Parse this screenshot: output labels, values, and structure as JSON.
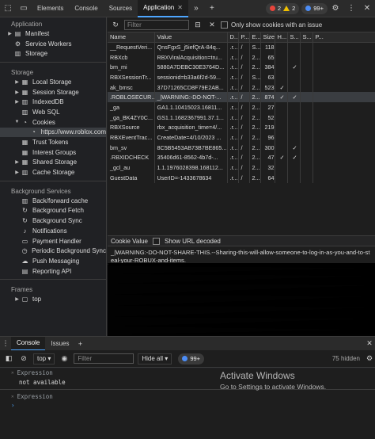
{
  "toolbar": {
    "tabs": [
      "Elements",
      "Console",
      "Sources",
      "Application"
    ],
    "active_tab": "Application",
    "errors": "2",
    "warnings": "2",
    "issues": "99+"
  },
  "sidebar": {
    "application_title": "Application",
    "application_items": [
      "Manifest",
      "Service Workers",
      "Storage"
    ],
    "storage_title": "Storage",
    "storage_items": [
      "Local Storage",
      "Session Storage",
      "IndexedDB",
      "Web SQL",
      "Cookies",
      "https://www.roblox.com",
      "Trust Tokens",
      "Interest Groups",
      "Shared Storage",
      "Cache Storage"
    ],
    "background_title": "Background Services",
    "background_items": [
      "Back/forward cache",
      "Background Fetch",
      "Background Sync",
      "Notifications",
      "Payment Handler",
      "Periodic Background Sync",
      "Push Messaging",
      "Reporting API"
    ],
    "frames_title": "Frames",
    "frames_items": [
      "top"
    ]
  },
  "filter": {
    "placeholder": "Filter",
    "only_issue_label": "Only show cookies with an issue"
  },
  "table": {
    "headers": [
      "Name",
      "Value",
      "D...",
      "P...",
      "E...",
      "Size",
      "H...",
      "S...",
      "S...",
      "P..."
    ],
    "rows": [
      [
        "__RequestVeri...",
        "QnsFgxS_j5iefQrA-84q...",
        ".r...",
        "/",
        "S...",
        "118",
        "",
        "",
        "",
        ""
      ],
      [
        "RBXcb",
        "RBXViralAcquisition=tru...",
        ".r...",
        "/",
        "2...",
        "65",
        "",
        "",
        "",
        ""
      ],
      [
        "bm_mi",
        "5880A7DEBC30E3764D...",
        ".r...",
        "/",
        "2...",
        "384",
        "",
        "✓",
        "",
        ""
      ],
      [
        "RBXSessionTr...",
        "sessionid=b33a6f2d-59...",
        ".r...",
        "/",
        "S...",
        "63",
        "",
        "",
        "",
        ""
      ],
      [
        "ak_bmsc",
        "37D71265CD8F79E2AB...",
        ".r...",
        "/",
        "2...",
        "523",
        "✓",
        "",
        "",
        ""
      ],
      [
        ".ROBLOSECUR...",
        "_|WARNING:-DO-NOT-...",
        ".r...",
        "/",
        "2...",
        "874",
        "✓",
        "✓",
        "",
        ""
      ],
      [
        "_ga",
        "GA1.1.10415023.16811...",
        ".r...",
        "/",
        "2...",
        "27",
        "",
        "",
        "",
        ""
      ],
      [
        "_ga_BK4ZY0C...",
        "GS1.1.1682367991.37.1...",
        ".r...",
        "/",
        "2...",
        "52",
        "",
        "",
        "",
        ""
      ],
      [
        "RBXSource",
        "rbx_acquisition_time=4/...",
        ".r...",
        "/",
        "2...",
        "219",
        "",
        "",
        "",
        ""
      ],
      [
        "RBXEventTrac...",
        "CreateDate=4/10/2023 ...",
        ".r...",
        "/",
        "2...",
        "96",
        "",
        "",
        "",
        ""
      ],
      [
        "bm_sv",
        "8C5B5453AB73B7BE865...",
        ".r...",
        "/",
        "2...",
        "300",
        "",
        "✓",
        "",
        ""
      ],
      [
        ".RBXIDCHECK",
        "35406d61-8562-4b7d-...",
        ".r...",
        "/",
        "2...",
        "47",
        "✓",
        "✓",
        "",
        ""
      ],
      [
        "_gcl_au",
        "1.1.1976028398.168112...",
        ".r...",
        "/",
        "2...",
        "32",
        "",
        "",
        "",
        ""
      ],
      [
        "GuestData",
        "UserID=-1433678634",
        ".r...",
        "/",
        "2...",
        "64",
        "",
        "",
        "",
        ""
      ]
    ],
    "selected_row": 5
  },
  "cookie_value": {
    "title": "Cookie Value",
    "show_url_label": "Show URL decoded",
    "text": "_|WARNING:-DO-NOT-SHARE-THIS.--Sharing-this-will-allow-someone-to-log-in-as-you-and-to-steal-your-ROBUX-and-items."
  },
  "drawer": {
    "tabs": [
      "Console",
      "Issues"
    ],
    "context": "top",
    "filter_placeholder": "Filter",
    "levels": "Hide all",
    "issues": "99+",
    "hidden": "75 hidden",
    "expressions": [
      {
        "label": "Expression",
        "value": "not available"
      },
      {
        "label": "Expression",
        "value": ""
      }
    ],
    "prompt": "›"
  },
  "watermark": {
    "line1": "Activate Windows",
    "line2": "Go to Settings to activate Windows."
  },
  "colors": {
    "accent": "#4ea6ff",
    "error": "#e8453c",
    "warning": "#f0c000",
    "info": "#4c8df6"
  }
}
